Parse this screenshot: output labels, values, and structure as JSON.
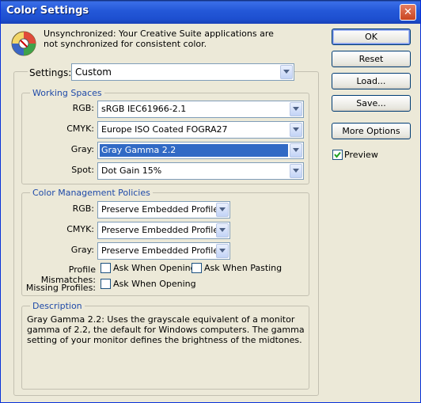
{
  "window": {
    "title": "Color Settings",
    "close_glyph": "✕"
  },
  "message": "Unsynchronized: Your Creative Suite applications are not synchronized for consistent color.",
  "settings": {
    "label": "Settings:",
    "value": "Custom"
  },
  "working_spaces": {
    "title": "Working Spaces",
    "rgb_label": "RGB:",
    "rgb_value": "sRGB IEC61966-2.1",
    "cmyk_label": "CMYK:",
    "cmyk_value": "Europe ISO Coated FOGRA27",
    "gray_label": "Gray:",
    "gray_value": "Gray Gamma 2.2",
    "spot_label": "Spot:",
    "spot_value": "Dot Gain 15%"
  },
  "policies": {
    "title": "Color Management Policies",
    "rgb_label": "RGB:",
    "rgb_value": "Preserve Embedded Profiles",
    "cmyk_label": "CMYK:",
    "cmyk_value": "Preserve Embedded Profiles",
    "gray_label": "Gray:",
    "gray_value": "Preserve Embedded Profiles",
    "mismatch_label": "Profile Mismatches:",
    "ask_opening_label": "Ask When Opening",
    "ask_pasting_label": "Ask When Pasting",
    "missing_label": "Missing Profiles:",
    "missing_ask_opening_label": "Ask When Opening",
    "mismatch_ask_opening_checked": false,
    "mismatch_ask_pasting_checked": false,
    "missing_ask_opening_checked": false
  },
  "description": {
    "title": "Description",
    "text": "Gray Gamma 2.2:  Uses the grayscale equivalent of a monitor gamma of 2.2, the default for Windows computers.  The gamma setting of your monitor defines the brightness of the midtones."
  },
  "buttons": {
    "ok": "OK",
    "reset": "Reset",
    "load": "Load...",
    "save": "Save...",
    "more_options": "More Options"
  },
  "preview": {
    "label": "Preview",
    "checked": true
  },
  "colors": {
    "accent": "#316ac5",
    "group_title": "#1f4aa8",
    "title_bar": "#2458d8"
  }
}
